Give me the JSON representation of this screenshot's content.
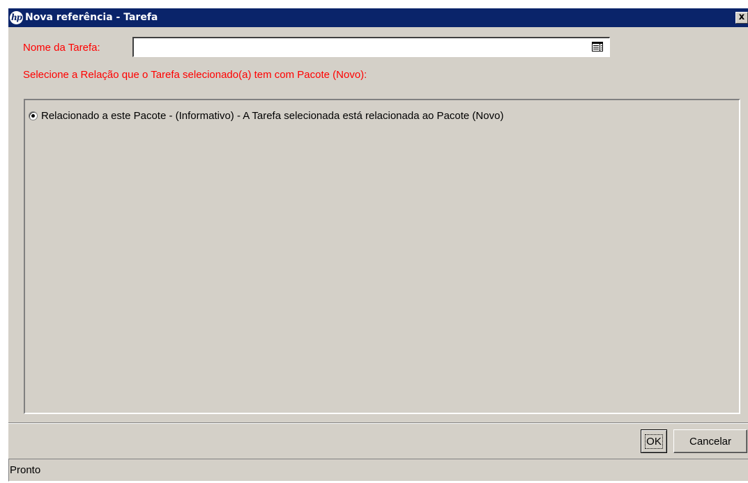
{
  "window": {
    "title": "Nova referência - Tarefa",
    "logo_text": "hp",
    "close_symbol": "x"
  },
  "form": {
    "task_name_label": "Nome da Tarefa:",
    "task_name_value": "",
    "task_name_icon": "list-picker-icon",
    "relation_prompt": "Selecione a Relação que o Tarefa selecionado(a) tem com Pacote (Novo):"
  },
  "relations": [
    {
      "label": "Relacionado a este Pacote - (Informativo) - A Tarefa selecionada está relacionada ao Pacote (Novo)",
      "selected": true
    }
  ],
  "buttons": {
    "ok": "OK",
    "cancel": "Cancelar"
  },
  "status": {
    "text": "Pronto"
  },
  "colors": {
    "titlebar": "#0a246a",
    "dialog_bg": "#d4d0c8",
    "required_label": "#ff0000"
  }
}
